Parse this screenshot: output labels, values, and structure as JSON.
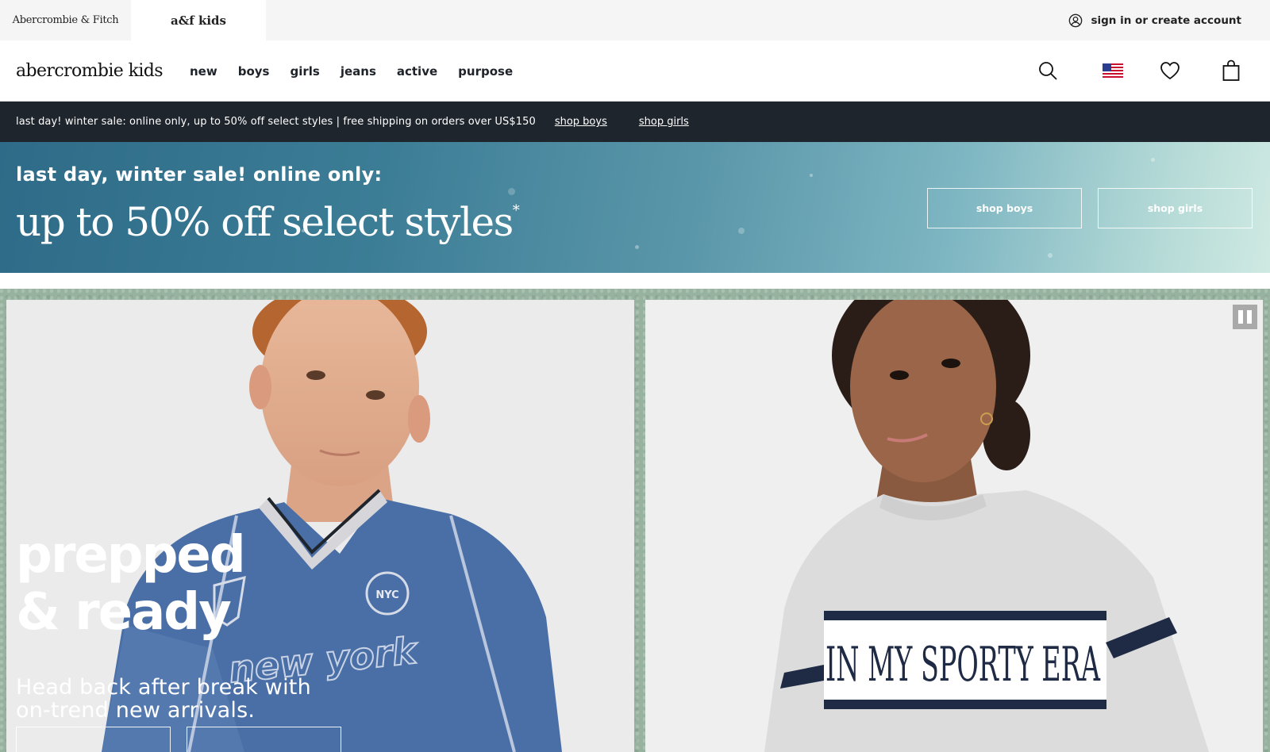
{
  "brandbar": {
    "af_tab": "Abercrombie & Fitch",
    "kids_tab": "a&f kids",
    "account_label": "sign in or create account",
    "account_icon": "user-circle-icon"
  },
  "nav": {
    "logo": "abercrombie kids",
    "links": [
      "new",
      "boys",
      "girls",
      "jeans",
      "active",
      "purpose"
    ],
    "icons": [
      "search-icon",
      "us-flag-icon",
      "heart-icon",
      "shopping-bag-icon"
    ]
  },
  "promo": {
    "text": "last day! winter sale: online only, up to 50% off select styles | free shipping on orders over US$150",
    "link_boys": "shop boys",
    "link_girls": "shop girls"
  },
  "sale": {
    "eyebrow": "last day, winter sale! online only:",
    "headline": "up to 50% off select styles",
    "asterisk": "*",
    "btn_boys": "shop boys",
    "btn_girls": "shop girls"
  },
  "hero": {
    "title_line1": "prepped",
    "title_line2": "& ready",
    "sub_line1": "Head back after break with",
    "sub_line2": "on-trend new arrivals.",
    "jersey_text": "new york",
    "jersey_crest": "NYC",
    "sweater_text": "IN MY SPORTY ERA",
    "pause_icon": "pause-icon"
  },
  "colors": {
    "dark_strip": "#1f252d",
    "banner_blue": "#3c7d96",
    "hero_green": "#97b3a0",
    "jersey_blue": "#4a6fa6",
    "sweater_grey": "#dcdcdc"
  }
}
